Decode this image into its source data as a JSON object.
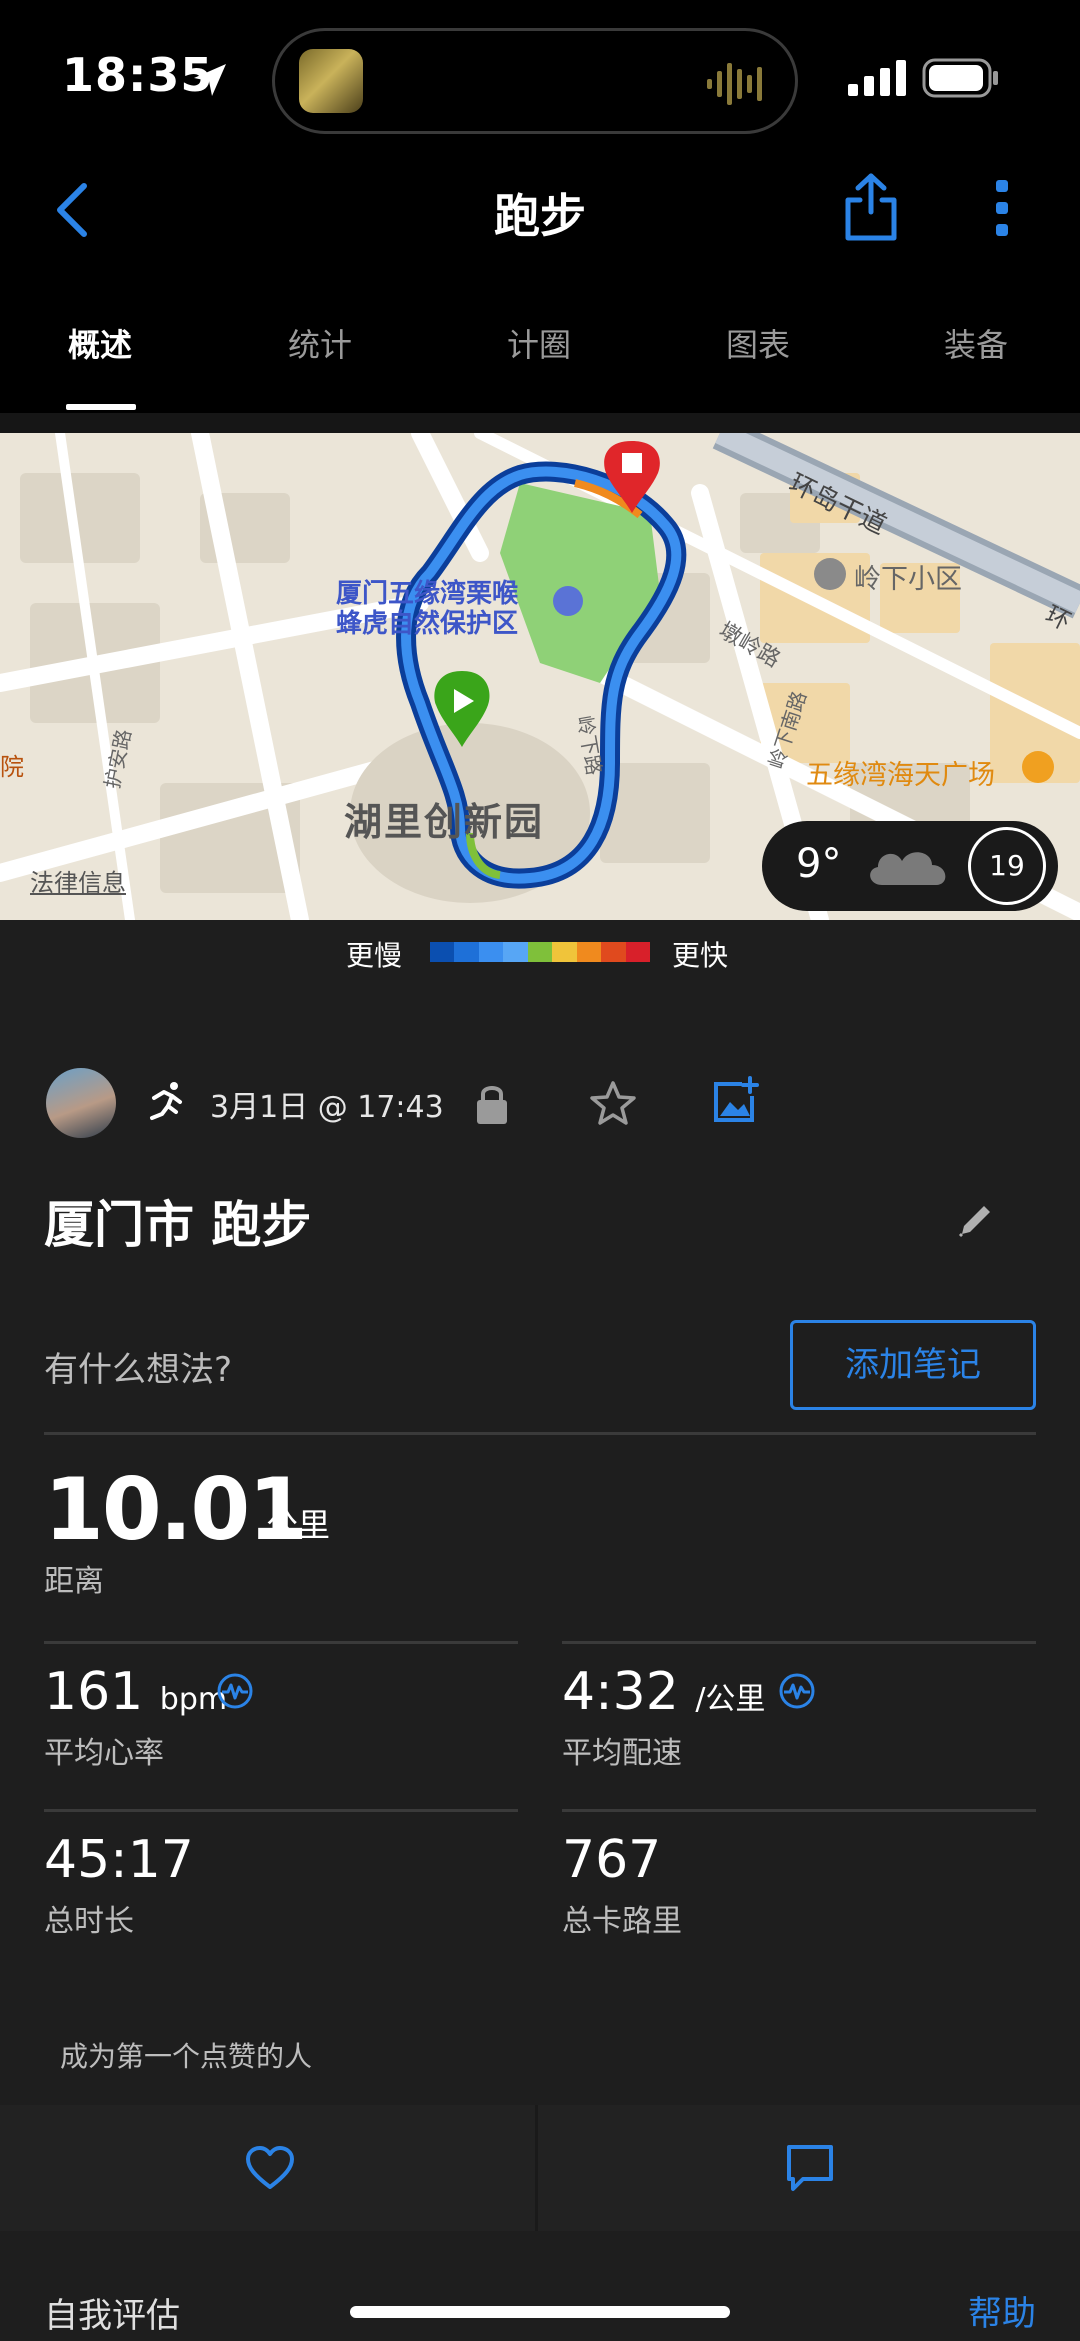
{
  "status_bar": {
    "time": "18:35"
  },
  "header": {
    "title": "跑步",
    "back_icon": "chevron-left-icon",
    "share_icon": "share-icon",
    "more_icon": "more-vertical-icon"
  },
  "tabs": [
    {
      "label": "概述",
      "active": true
    },
    {
      "label": "统计",
      "active": false
    },
    {
      "label": "计圈",
      "active": false
    },
    {
      "label": "图表",
      "active": false
    },
    {
      "label": "装备",
      "active": false
    }
  ],
  "map": {
    "labels": {
      "park": "厦门五缘湾栗喉\n蜂虎自然保护区",
      "area_main": "湖里创新园",
      "road_ring": "环岛干道",
      "district": "岭下小区",
      "road_dunling": "墩岭路",
      "road_ling": "岭下路",
      "road_ling2": "岭下南路",
      "road_huan": "护安路",
      "mall": "五缘湾海天广场",
      "legal": "法律信息",
      "edge_left": "院",
      "edge_right": "环"
    },
    "weather": {
      "temp": "9°",
      "wind": "19"
    }
  },
  "legend": {
    "slow": "更慢",
    "fast": "更快",
    "colors": [
      "#0b4fb0",
      "#1e70d8",
      "#3b8ff0",
      "#57a6f5",
      "#7fc03a",
      "#f0c43a",
      "#f08a1e",
      "#e04a1e",
      "#d8202a"
    ]
  },
  "activity": {
    "date": "3月1日 @ 17:43",
    "title": "厦门市 跑步",
    "prompt": "有什么想法?",
    "add_note": "添加笔记"
  },
  "stats": {
    "distance": {
      "value": "10.01",
      "unit": "公里",
      "label": "距离"
    },
    "heart_rate": {
      "value": "161",
      "unit": "bpm",
      "label": "平均心率"
    },
    "pace": {
      "value": "4:32",
      "unit": "/公里",
      "label": "平均配速"
    },
    "duration": {
      "value": "45:17",
      "label": "总时长"
    },
    "calories": {
      "value": "767",
      "label": "总卡路里"
    }
  },
  "social": {
    "likes_text": "成为第一个点赞的人"
  },
  "footer": {
    "self_eval": "自我评估",
    "help": "帮助"
  }
}
